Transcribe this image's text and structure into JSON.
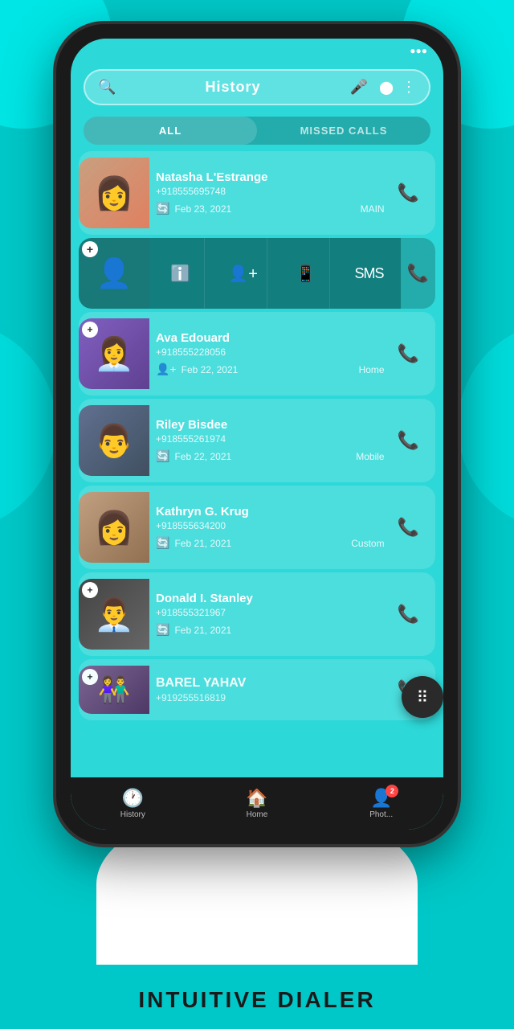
{
  "background": {
    "color": "#00c8c8"
  },
  "search": {
    "placeholder": "History",
    "label": "History"
  },
  "tabs": [
    {
      "id": "all",
      "label": "ALL",
      "active": true
    },
    {
      "id": "missed",
      "label": "MISSED CALLS",
      "active": false
    }
  ],
  "contacts": [
    {
      "id": 1,
      "name": "Natasha L'Estrange",
      "number": "+918555695748",
      "date": "Feb 23, 2021",
      "type": "MAIN",
      "hasPhoto": true,
      "avatarColor": "avatar-bg-1",
      "avatarEmoji": "👩"
    },
    {
      "id": 2,
      "name": "",
      "number": "",
      "date": "",
      "type": "",
      "hasPhoto": false,
      "expanded": true,
      "avatarEmoji": "👤"
    },
    {
      "id": 3,
      "name": "Ava Edouard",
      "number": "+918555228056",
      "date": "Feb 22, 2021",
      "type": "Home",
      "hasPhoto": true,
      "avatarColor": "avatar-bg-2",
      "avatarEmoji": "👩‍💼",
      "addContact": true
    },
    {
      "id": 4,
      "name": "Riley Bisdee",
      "number": "+918555261974",
      "date": "Feb 22, 2021",
      "type": "Mobile",
      "hasPhoto": true,
      "avatarColor": "avatar-bg-3",
      "avatarEmoji": "👨"
    },
    {
      "id": 5,
      "name": "Kathryn G. Krug",
      "number": "+918555634200",
      "date": "Feb 21, 2021",
      "type": "Custom",
      "hasPhoto": true,
      "avatarColor": "avatar-bg-4",
      "avatarEmoji": "👩"
    },
    {
      "id": 6,
      "name": "Donald I. Stanley",
      "number": "+918555321967",
      "date": "Feb 21, 2021",
      "type": "",
      "hasPhoto": true,
      "avatarColor": "avatar-bg-5",
      "avatarEmoji": "👨‍💼",
      "addContact": true
    },
    {
      "id": 7,
      "name": "BAREL YAHAV",
      "number": "+919255516819",
      "date": "",
      "type": "",
      "hasPhoto": true,
      "avatarColor": "avatar-bg-6",
      "avatarEmoji": "👫",
      "addContact": true
    }
  ],
  "expandedActions": [
    {
      "icon": "ℹ️",
      "label": "info"
    },
    {
      "icon": "👤+",
      "label": "add-contact"
    },
    {
      "icon": "📱",
      "label": "whatsapp"
    },
    {
      "icon": "💬",
      "label": "sms"
    }
  ],
  "fab": {
    "icon": "⠿",
    "label": "dialpad"
  },
  "bottomNav": [
    {
      "id": "history",
      "icon": "🕐",
      "label": "History"
    },
    {
      "id": "home",
      "icon": "🏠",
      "label": "Home"
    },
    {
      "id": "photos",
      "icon": "👤",
      "label": "Phot...",
      "badge": "2"
    }
  ],
  "appTitle": "INTUITIVE DIALER"
}
